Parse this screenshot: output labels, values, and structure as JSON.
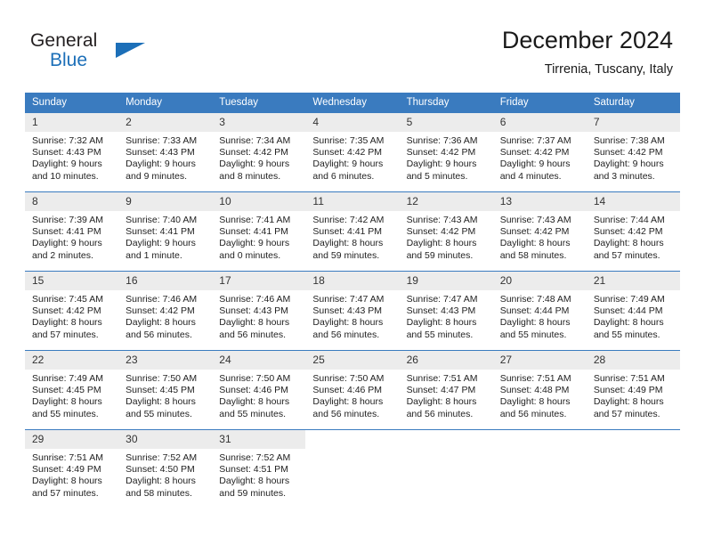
{
  "brand": {
    "name_part1": "General",
    "name_part2": "Blue",
    "accent_color": "#1c6fb8"
  },
  "header": {
    "title": "December 2024",
    "subtitle": "Tirrenia, Tuscany, Italy"
  },
  "calendar": {
    "header_bg": "#3a7bbf",
    "daynum_bg": "#ececec",
    "weekday_headers": [
      "Sunday",
      "Monday",
      "Tuesday",
      "Wednesday",
      "Thursday",
      "Friday",
      "Saturday"
    ],
    "weeks": [
      [
        {
          "day": "1",
          "sunrise": "Sunrise: 7:32 AM",
          "sunset": "Sunset: 4:43 PM",
          "daylight1": "Daylight: 9 hours",
          "daylight2": "and 10 minutes."
        },
        {
          "day": "2",
          "sunrise": "Sunrise: 7:33 AM",
          "sunset": "Sunset: 4:43 PM",
          "daylight1": "Daylight: 9 hours",
          "daylight2": "and 9 minutes."
        },
        {
          "day": "3",
          "sunrise": "Sunrise: 7:34 AM",
          "sunset": "Sunset: 4:42 PM",
          "daylight1": "Daylight: 9 hours",
          "daylight2": "and 8 minutes."
        },
        {
          "day": "4",
          "sunrise": "Sunrise: 7:35 AM",
          "sunset": "Sunset: 4:42 PM",
          "daylight1": "Daylight: 9 hours",
          "daylight2": "and 6 minutes."
        },
        {
          "day": "5",
          "sunrise": "Sunrise: 7:36 AM",
          "sunset": "Sunset: 4:42 PM",
          "daylight1": "Daylight: 9 hours",
          "daylight2": "and 5 minutes."
        },
        {
          "day": "6",
          "sunrise": "Sunrise: 7:37 AM",
          "sunset": "Sunset: 4:42 PM",
          "daylight1": "Daylight: 9 hours",
          "daylight2": "and 4 minutes."
        },
        {
          "day": "7",
          "sunrise": "Sunrise: 7:38 AM",
          "sunset": "Sunset: 4:42 PM",
          "daylight1": "Daylight: 9 hours",
          "daylight2": "and 3 minutes."
        }
      ],
      [
        {
          "day": "8",
          "sunrise": "Sunrise: 7:39 AM",
          "sunset": "Sunset: 4:41 PM",
          "daylight1": "Daylight: 9 hours",
          "daylight2": "and 2 minutes."
        },
        {
          "day": "9",
          "sunrise": "Sunrise: 7:40 AM",
          "sunset": "Sunset: 4:41 PM",
          "daylight1": "Daylight: 9 hours",
          "daylight2": "and 1 minute."
        },
        {
          "day": "10",
          "sunrise": "Sunrise: 7:41 AM",
          "sunset": "Sunset: 4:41 PM",
          "daylight1": "Daylight: 9 hours",
          "daylight2": "and 0 minutes."
        },
        {
          "day": "11",
          "sunrise": "Sunrise: 7:42 AM",
          "sunset": "Sunset: 4:41 PM",
          "daylight1": "Daylight: 8 hours",
          "daylight2": "and 59 minutes."
        },
        {
          "day": "12",
          "sunrise": "Sunrise: 7:43 AM",
          "sunset": "Sunset: 4:42 PM",
          "daylight1": "Daylight: 8 hours",
          "daylight2": "and 59 minutes."
        },
        {
          "day": "13",
          "sunrise": "Sunrise: 7:43 AM",
          "sunset": "Sunset: 4:42 PM",
          "daylight1": "Daylight: 8 hours",
          "daylight2": "and 58 minutes."
        },
        {
          "day": "14",
          "sunrise": "Sunrise: 7:44 AM",
          "sunset": "Sunset: 4:42 PM",
          "daylight1": "Daylight: 8 hours",
          "daylight2": "and 57 minutes."
        }
      ],
      [
        {
          "day": "15",
          "sunrise": "Sunrise: 7:45 AM",
          "sunset": "Sunset: 4:42 PM",
          "daylight1": "Daylight: 8 hours",
          "daylight2": "and 57 minutes."
        },
        {
          "day": "16",
          "sunrise": "Sunrise: 7:46 AM",
          "sunset": "Sunset: 4:42 PM",
          "daylight1": "Daylight: 8 hours",
          "daylight2": "and 56 minutes."
        },
        {
          "day": "17",
          "sunrise": "Sunrise: 7:46 AM",
          "sunset": "Sunset: 4:43 PM",
          "daylight1": "Daylight: 8 hours",
          "daylight2": "and 56 minutes."
        },
        {
          "day": "18",
          "sunrise": "Sunrise: 7:47 AM",
          "sunset": "Sunset: 4:43 PM",
          "daylight1": "Daylight: 8 hours",
          "daylight2": "and 56 minutes."
        },
        {
          "day": "19",
          "sunrise": "Sunrise: 7:47 AM",
          "sunset": "Sunset: 4:43 PM",
          "daylight1": "Daylight: 8 hours",
          "daylight2": "and 55 minutes."
        },
        {
          "day": "20",
          "sunrise": "Sunrise: 7:48 AM",
          "sunset": "Sunset: 4:44 PM",
          "daylight1": "Daylight: 8 hours",
          "daylight2": "and 55 minutes."
        },
        {
          "day": "21",
          "sunrise": "Sunrise: 7:49 AM",
          "sunset": "Sunset: 4:44 PM",
          "daylight1": "Daylight: 8 hours",
          "daylight2": "and 55 minutes."
        }
      ],
      [
        {
          "day": "22",
          "sunrise": "Sunrise: 7:49 AM",
          "sunset": "Sunset: 4:45 PM",
          "daylight1": "Daylight: 8 hours",
          "daylight2": "and 55 minutes."
        },
        {
          "day": "23",
          "sunrise": "Sunrise: 7:50 AM",
          "sunset": "Sunset: 4:45 PM",
          "daylight1": "Daylight: 8 hours",
          "daylight2": "and 55 minutes."
        },
        {
          "day": "24",
          "sunrise": "Sunrise: 7:50 AM",
          "sunset": "Sunset: 4:46 PM",
          "daylight1": "Daylight: 8 hours",
          "daylight2": "and 55 minutes."
        },
        {
          "day": "25",
          "sunrise": "Sunrise: 7:50 AM",
          "sunset": "Sunset: 4:46 PM",
          "daylight1": "Daylight: 8 hours",
          "daylight2": "and 56 minutes."
        },
        {
          "day": "26",
          "sunrise": "Sunrise: 7:51 AM",
          "sunset": "Sunset: 4:47 PM",
          "daylight1": "Daylight: 8 hours",
          "daylight2": "and 56 minutes."
        },
        {
          "day": "27",
          "sunrise": "Sunrise: 7:51 AM",
          "sunset": "Sunset: 4:48 PM",
          "daylight1": "Daylight: 8 hours",
          "daylight2": "and 56 minutes."
        },
        {
          "day": "28",
          "sunrise": "Sunrise: 7:51 AM",
          "sunset": "Sunset: 4:49 PM",
          "daylight1": "Daylight: 8 hours",
          "daylight2": "and 57 minutes."
        }
      ],
      [
        {
          "day": "29",
          "sunrise": "Sunrise: 7:51 AM",
          "sunset": "Sunset: 4:49 PM",
          "daylight1": "Daylight: 8 hours",
          "daylight2": "and 57 minutes."
        },
        {
          "day": "30",
          "sunrise": "Sunrise: 7:52 AM",
          "sunset": "Sunset: 4:50 PM",
          "daylight1": "Daylight: 8 hours",
          "daylight2": "and 58 minutes."
        },
        {
          "day": "31",
          "sunrise": "Sunrise: 7:52 AM",
          "sunset": "Sunset: 4:51 PM",
          "daylight1": "Daylight: 8 hours",
          "daylight2": "and 59 minutes."
        },
        {
          "day": "",
          "sunrise": "",
          "sunset": "",
          "daylight1": "",
          "daylight2": ""
        },
        {
          "day": "",
          "sunrise": "",
          "sunset": "",
          "daylight1": "",
          "daylight2": ""
        },
        {
          "day": "",
          "sunrise": "",
          "sunset": "",
          "daylight1": "",
          "daylight2": ""
        },
        {
          "day": "",
          "sunrise": "",
          "sunset": "",
          "daylight1": "",
          "daylight2": ""
        }
      ]
    ]
  }
}
